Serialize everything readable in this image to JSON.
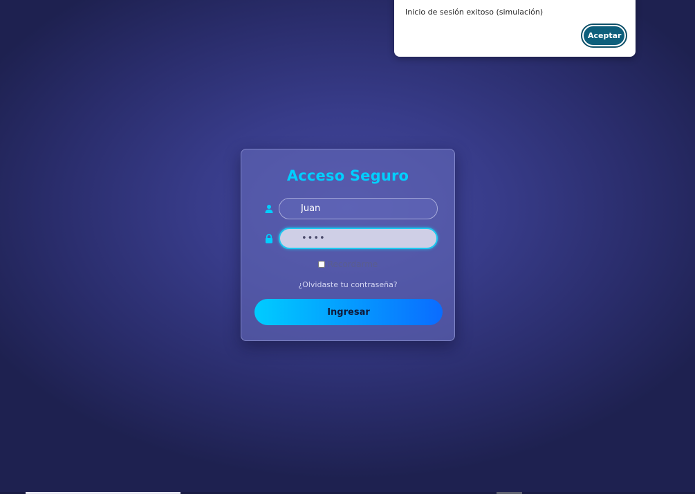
{
  "login": {
    "title": "Acceso Seguro",
    "username": {
      "value": "Juan",
      "icon": "user-icon"
    },
    "password": {
      "value": "••••",
      "icon": "lock-icon"
    },
    "remember_label": "Recordarme",
    "remember_checked": false,
    "forgot_link": "¿Olvidaste tu contraseña?",
    "submit_label": "Ingresar"
  },
  "alert": {
    "message": "Inicio de sesión exitoso (simulación)",
    "accept_label": "Aceptar"
  },
  "colors": {
    "accent": "#00cfff",
    "button_gradient_start": "#00ccff",
    "button_gradient_end": "#0a6cff",
    "accept_button": "#0d5f7c",
    "background": "#383c8a"
  }
}
